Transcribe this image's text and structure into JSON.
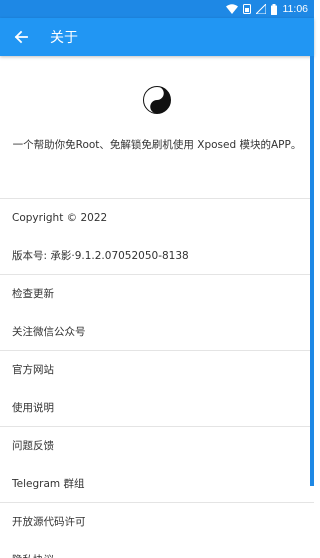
{
  "status_bar": {
    "time": "11:06"
  },
  "app_bar": {
    "title": "关于"
  },
  "about": {
    "description": "一个帮助你免Root、免解锁免刷机使用 Xposed 模块的APP。"
  },
  "rows": {
    "copyright": "Copyright © 2022",
    "version": "版本号: 承影·9.1.2.07052050-8138",
    "check_update": "检查更新",
    "follow_wechat": "关注微信公众号",
    "official_site": "官方网站",
    "instructions": "使用说明",
    "feedback": "问题反馈",
    "telegram": "Telegram 群组",
    "open_source": "开放源代码许可",
    "privacy": "隐私协议"
  },
  "colors": {
    "primary": "#2196f3",
    "status_bar": "#1e88e5"
  }
}
